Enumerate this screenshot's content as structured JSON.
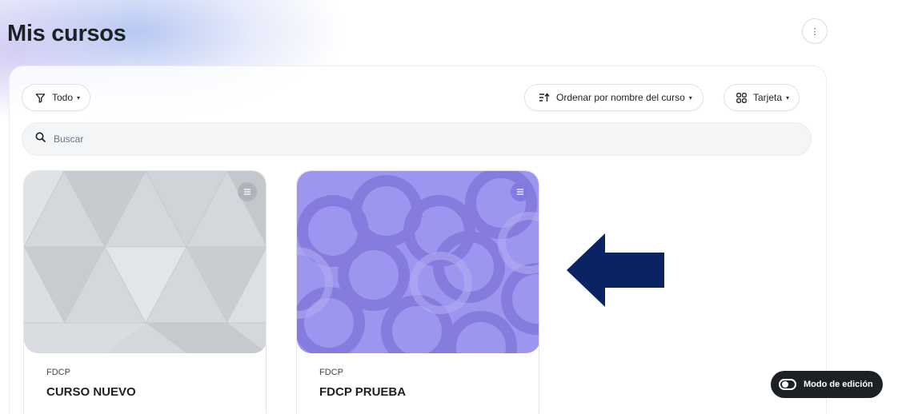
{
  "page": {
    "title": "Mis cursos"
  },
  "actions": {
    "kebab_icon": "more-vertical-icon"
  },
  "filters": {
    "status_label": "Todo",
    "sort_label": "Ordenar por nombre del curso",
    "view_label": "Tarjeta"
  },
  "search": {
    "placeholder": "Buscar",
    "value": ""
  },
  "courses": [
    {
      "category": "FDCP",
      "name": "CURSO NUEVO",
      "thumbnail": "gray-triangle-pattern"
    },
    {
      "category": "FDCP",
      "name": "FDCP PRUEBA",
      "thumbnail": "purple-circle-pattern"
    }
  ],
  "annotation": {
    "arrow": "left-arrow",
    "color": "#0a2463"
  },
  "edit_mode": {
    "label": "Modo de edición",
    "enabled": false
  },
  "colors": {
    "text": "#1d2125",
    "course_1_thumb": "#d4d7db",
    "course_2_thumb": "#9d96ee",
    "menu_dot": "#b0b4ba",
    "dark_button": "#1d2125"
  }
}
